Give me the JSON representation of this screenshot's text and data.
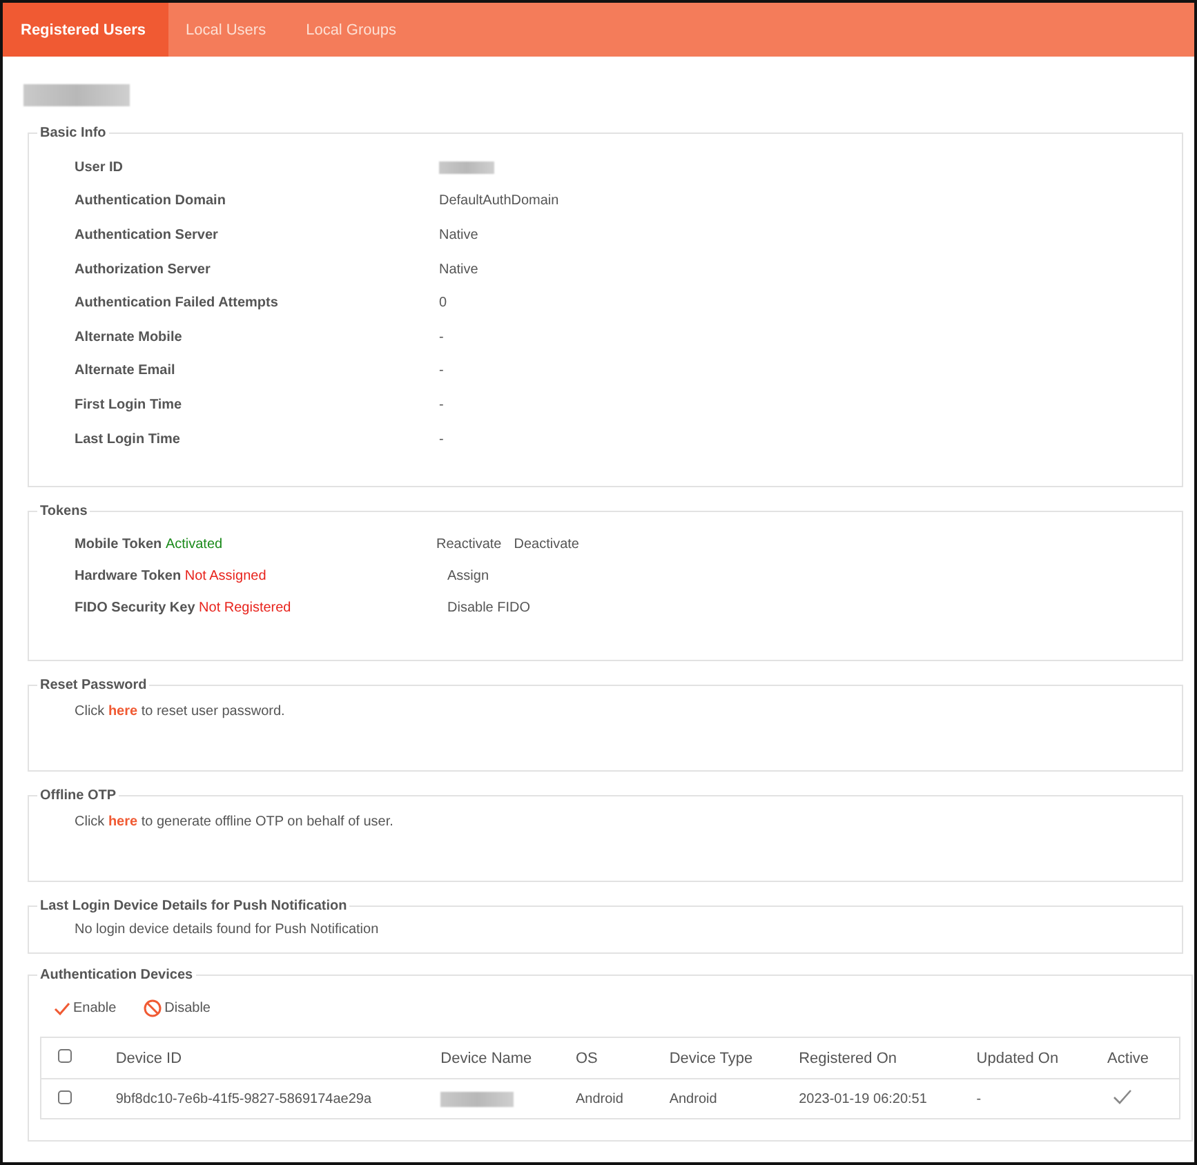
{
  "tabs": [
    {
      "label": "Registered Users",
      "selected": true
    },
    {
      "label": "Local Users",
      "selected": false
    },
    {
      "label": "Local Groups",
      "selected": false
    }
  ],
  "user": {
    "redacted": true
  },
  "basic_info": {
    "title": "Basic Info",
    "rows": [
      {
        "label": "User ID",
        "redacted": true
      },
      {
        "label": "Authentication Domain",
        "value": "DefaultAuthDomain"
      },
      {
        "label": "Authentication Server",
        "value": "Native"
      },
      {
        "label": "Authorization Server",
        "value": "Native"
      },
      {
        "label": "Authentication Failed Attempts",
        "value": "0"
      },
      {
        "label": "Alternate Mobile",
        "value": "-"
      },
      {
        "label": "Alternate Email",
        "value": "-"
      },
      {
        "label": "First Login Time",
        "value": "-"
      },
      {
        "label": "Last Login Time",
        "value": "-"
      }
    ]
  },
  "tokens": {
    "title": "Tokens",
    "rows": [
      {
        "label": "Mobile Token",
        "status": "Activated",
        "color": "#1a8a1a",
        "actions": [
          "Reactivate",
          "Deactivate"
        ]
      },
      {
        "label": "Hardware Token",
        "status": "Not Assigned",
        "color": "#e8231c",
        "actions": [
          "Assign"
        ]
      },
      {
        "label": "FIDO Security Key",
        "status": "Not Registered",
        "color": "#e8231c",
        "actions": [
          "Disable FIDO"
        ]
      }
    ]
  },
  "reset_password": {
    "title": "Reset Password",
    "before": "Click",
    "link": "here",
    "after": "to reset user password."
  },
  "offline_otp": {
    "title": "Offline OTP",
    "before": "Click",
    "link": "here",
    "after": "to generate offline OTP on behalf of user."
  },
  "push_device": {
    "title": "Last Login Device Details for Push Notification",
    "message": "No login device details found for Push Notification"
  },
  "devices": {
    "title": "Authentication Devices",
    "enable": "Enable",
    "disable": "Disable",
    "columns": [
      "Device ID",
      "Device Name",
      "OS",
      "Device Type",
      "Registered On",
      "Updated On",
      "Active"
    ],
    "rows": [
      {
        "checked": false,
        "device_id": "9bf8dc10-7e6b-41f5-9827-5869174ae29a",
        "name_redacted": true,
        "os": "Android",
        "device_type": "Android",
        "registered_on": "2023-01-19 06:20:51",
        "updated_on": "-",
        "active": true
      }
    ],
    "all_checked": false
  }
}
